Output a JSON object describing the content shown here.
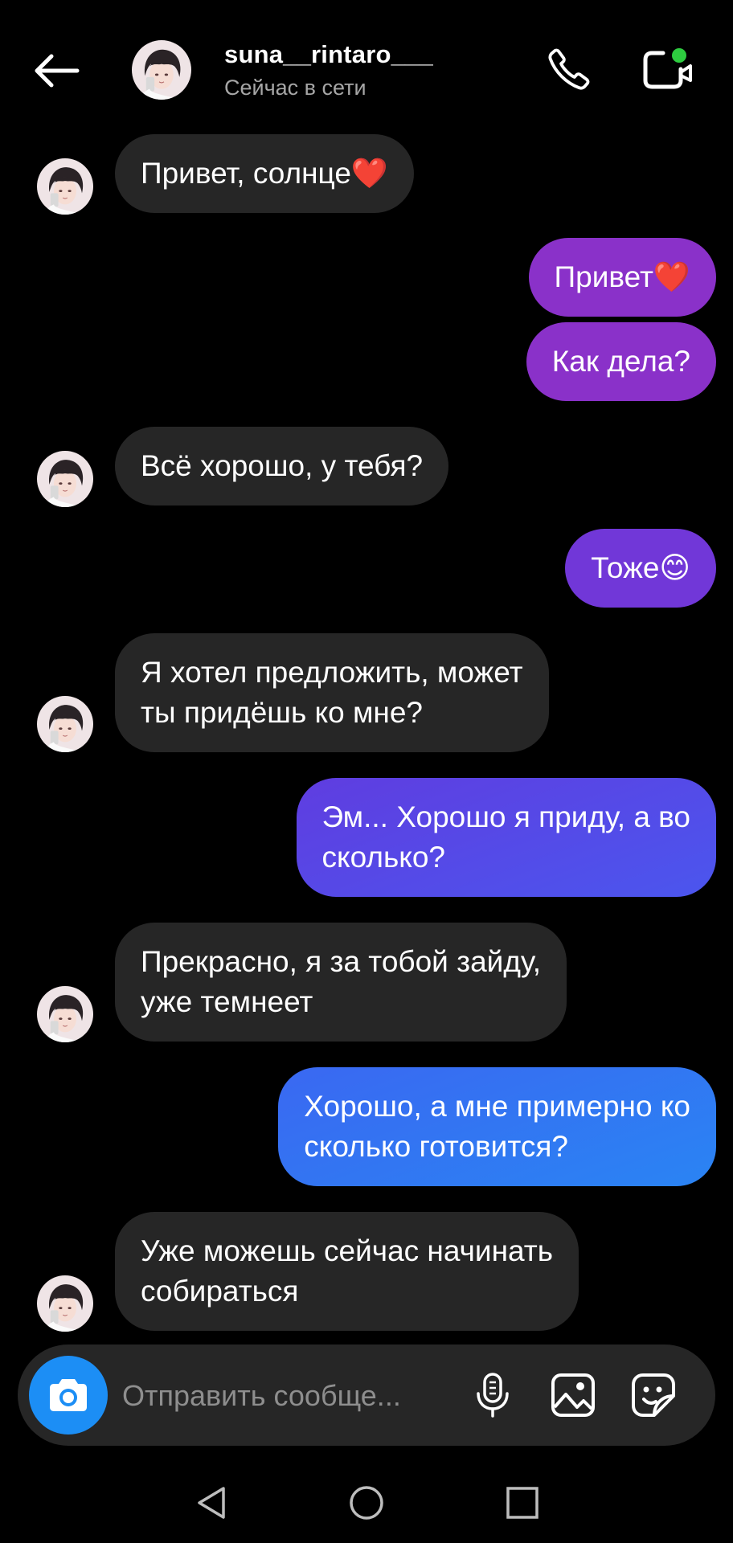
{
  "header": {
    "back_icon": "arrow-left-icon",
    "username": "suna__rintaro___",
    "status": "Сейчас в сети",
    "call_icon": "phone-icon",
    "video_icon": "video-camera-icon",
    "online_color": "#2ecc40"
  },
  "messages": [
    {
      "from": "them",
      "text": "Привет, солнце❤️"
    },
    {
      "from": "me",
      "text": "Привет❤️"
    },
    {
      "from": "me",
      "text": "Как дела?"
    },
    {
      "from": "them",
      "text": "Всё хорошо, у тебя?"
    },
    {
      "from": "me",
      "text": "Тоже😊"
    },
    {
      "from": "them",
      "text": "Я хотел предложить, может\nты придёшь ко мне?"
    },
    {
      "from": "me",
      "text": "Эм... Хорошо я приду, а во\nсколько?"
    },
    {
      "from": "them",
      "text": "Прекрасно, я за тобой зайду,\nуже темнеет"
    },
    {
      "from": "me",
      "text": "Хорошо, а мне примерно ко\nсколько готовится?"
    },
    {
      "from": "them",
      "text": "Уже можешь сейчас начинать\nсобираться"
    }
  ],
  "composer": {
    "placeholder": "Отправить сообще...",
    "camera_icon": "camera-icon",
    "mic_icon": "microphone-icon",
    "gallery_icon": "image-icon",
    "sticker_icon": "sticker-icon"
  },
  "navbar": {
    "back_icon": "triangle-back-icon",
    "home_icon": "circle-home-icon",
    "recents_icon": "square-recents-icon"
  },
  "colors": {
    "incoming_bubble": "#262626",
    "outgoing_gradient": [
      "#8a31c9",
      "#7137d8",
      "#5f3de0",
      "#2a84f3"
    ],
    "camera_button": "#1c8ef5"
  }
}
